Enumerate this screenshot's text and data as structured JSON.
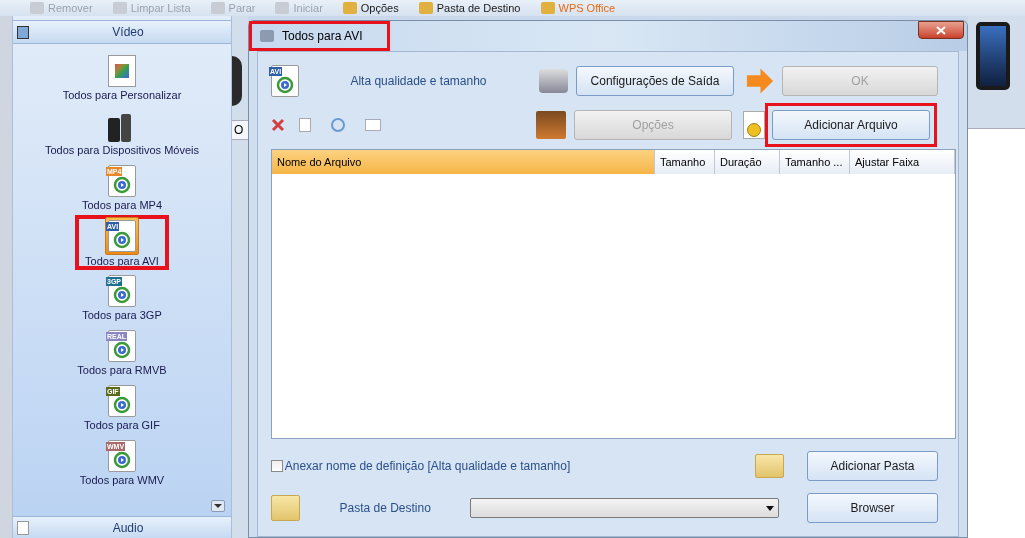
{
  "toolbar": [
    {
      "label": "Remover",
      "disabled": true
    },
    {
      "label": "Limpar Lista",
      "disabled": true
    },
    {
      "label": "Parar",
      "disabled": true
    },
    {
      "label": "Iniciar",
      "disabled": true
    },
    {
      "label": "Opções",
      "disabled": false
    },
    {
      "label": "Pasta de Destino",
      "disabled": false
    },
    {
      "label": "WPS Office",
      "disabled": false
    }
  ],
  "sidebar": {
    "header": "Vídeo",
    "footer": "Audio",
    "items": [
      {
        "label": "Todos para Personalizar",
        "selected": false,
        "highlighted": false
      },
      {
        "label": "Todos para Dispositivos Móveis",
        "selected": false,
        "highlighted": false
      },
      {
        "label": "Todos para MP4",
        "tag": "MP4",
        "color": "#e8872a",
        "selected": false,
        "highlighted": false
      },
      {
        "label": "Todos para AVI",
        "tag": "AVI",
        "color": "#2f5fa8",
        "selected": true,
        "highlighted": true
      },
      {
        "label": "Todos para 3GP",
        "tag": "3GP",
        "color": "#1f6f8f",
        "selected": false,
        "highlighted": false
      },
      {
        "label": "Todos para RMVB",
        "tag": "REAL",
        "color": "#8a86c0",
        "selected": false,
        "highlighted": false
      },
      {
        "label": "Todos para GIF",
        "tag": "GIF",
        "color": "#5a6a1a",
        "selected": false,
        "highlighted": false
      },
      {
        "label": "Todos para WMV",
        "tag": "WMV",
        "color": "#a86a6a",
        "selected": false,
        "highlighted": false
      }
    ]
  },
  "background_tab": "O",
  "dialog": {
    "title": "Todos para AVI",
    "title_highlighted": true,
    "preset_tag": "AVI",
    "preset": "Alta qualidade e tamanho",
    "buttons": [
      {
        "label": "Configurações de Saída",
        "disabled": false,
        "highlighted": false
      },
      {
        "label": "OK",
        "disabled": true,
        "highlighted": false
      },
      {
        "label": "Opções",
        "disabled": true,
        "highlighted": false
      },
      {
        "label": "Adicionar Arquivo",
        "disabled": false,
        "highlighted": true
      }
    ],
    "table": {
      "columns": [
        {
          "label": "Nome do Arquivo",
          "selected": true
        },
        {
          "label": "Tamanho",
          "selected": false
        },
        {
          "label": "Duração",
          "selected": false
        },
        {
          "label": "Tamanho ...",
          "selected": false
        },
        {
          "label": "Ajustar Faixa",
          "selected": false
        }
      ]
    },
    "append_name": {
      "label": "Anexar nome de definição [Alta qualidade e tamanho]",
      "checked": false
    },
    "add_folder": "Adicionar Pasta",
    "destination": {
      "label": "Pasta de Destino",
      "button": "Browser"
    }
  }
}
